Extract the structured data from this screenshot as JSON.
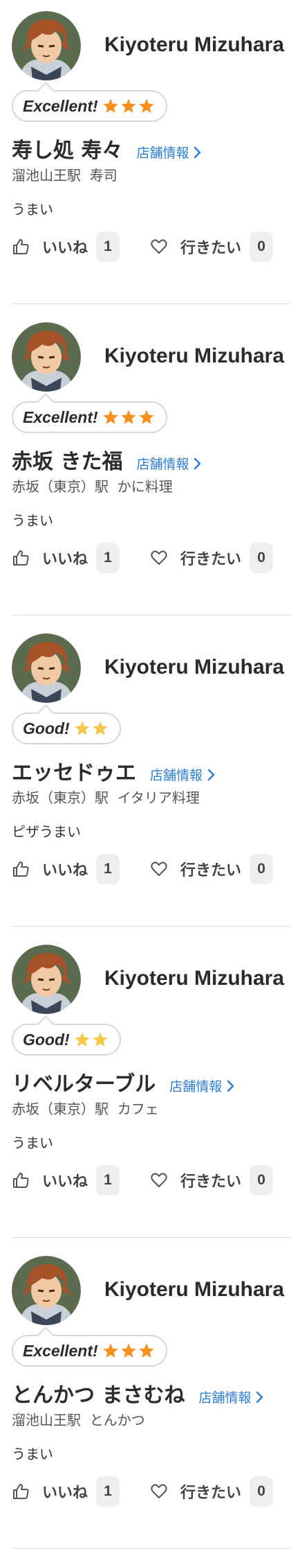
{
  "colors": {
    "link": "#2f7fd0",
    "star": "#f5901e",
    "star_light": "#f5c84a",
    "divider": "#dcdcdc"
  },
  "labels": {
    "shop_info": "店舗情報",
    "like": "いいね",
    "want_to_go": "行きたい"
  },
  "icons": {
    "like": "thumbs-up-icon",
    "want_to_go": "heart-icon",
    "shop_info": "chevron-right-icon",
    "rating": "star-icon"
  },
  "reviews": [
    {
      "user": "Kiyoteru Mizuhara",
      "rating_label": "Excellent!",
      "stars": 3,
      "shop_name": "寿し処 寿々",
      "station": "溜池山王駅",
      "genre": "寿司",
      "comment": "うまい",
      "likes": "1",
      "wants": "0"
    },
    {
      "user": "Kiyoteru Mizuhara",
      "rating_label": "Excellent!",
      "stars": 3,
      "shop_name": "赤坂 きた福",
      "station": "赤坂（東京）駅",
      "genre": "かに料理",
      "comment": "うまい",
      "likes": "1",
      "wants": "0"
    },
    {
      "user": "Kiyoteru Mizuhara",
      "rating_label": "Good!",
      "stars": 2,
      "shop_name": "エッセドゥエ",
      "station": "赤坂（東京）駅",
      "genre": "イタリア料理",
      "comment": "ピザうまい",
      "likes": "1",
      "wants": "0"
    },
    {
      "user": "Kiyoteru Mizuhara",
      "rating_label": "Good!",
      "stars": 2,
      "shop_name": "リベルターブル",
      "station": "赤坂（東京）駅",
      "genre": "カフェ",
      "comment": "うまい",
      "likes": "1",
      "wants": "0"
    },
    {
      "user": "Kiyoteru Mizuhara",
      "rating_label": "Excellent!",
      "stars": 3,
      "shop_name": "とんかつ まさむね",
      "station": "溜池山王駅",
      "genre": "とんかつ",
      "comment": "うまい",
      "likes": "1",
      "wants": "0"
    }
  ]
}
